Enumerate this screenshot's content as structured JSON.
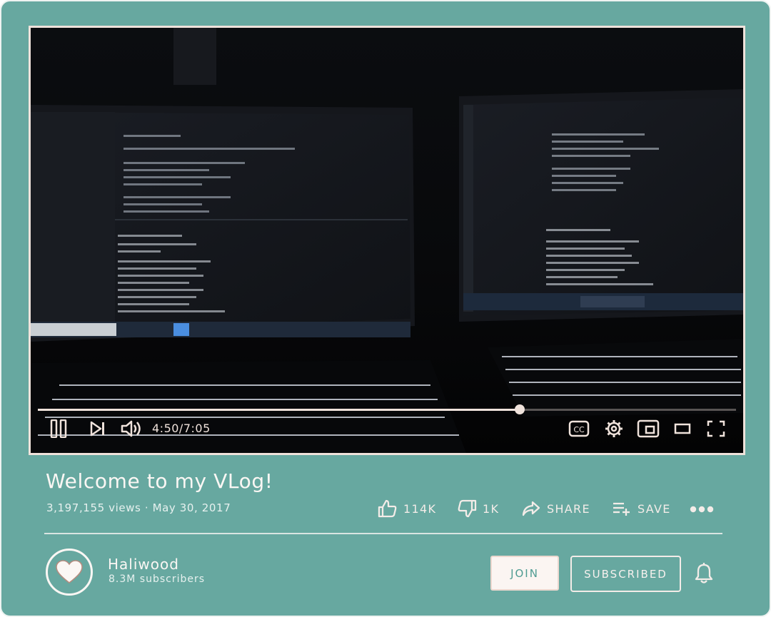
{
  "video": {
    "progress_fraction": 0.69,
    "time_display": "4:50/7:05"
  },
  "controls": {
    "pause_icon": "pause-icon",
    "next_icon": "skip-next-icon",
    "volume_icon": "volume-icon",
    "cc_label": "CC",
    "settings_icon": "gear-icon",
    "miniplayer_icon": "miniplayer-icon",
    "theater_icon": "theater-mode-icon",
    "fullscreen_icon": "fullscreen-icon"
  },
  "info": {
    "title": "Welcome to my VLog!",
    "views_date": "3,197,155 views · May 30, 2017"
  },
  "actions": {
    "like_count": "114K",
    "dislike_count": "1K",
    "share_label": "SHARE",
    "save_label": "SAVE"
  },
  "channel": {
    "name": "Haliwood",
    "subscribers": "8.3M subscribers",
    "avatar_icon": "heart-icon"
  },
  "buttons": {
    "join_label": "JOIN",
    "subscribed_label": "SUBSCRIBED"
  },
  "colors": {
    "background": "#67a8a0",
    "accent": "#efe2db",
    "text": "#fbf7f4"
  }
}
